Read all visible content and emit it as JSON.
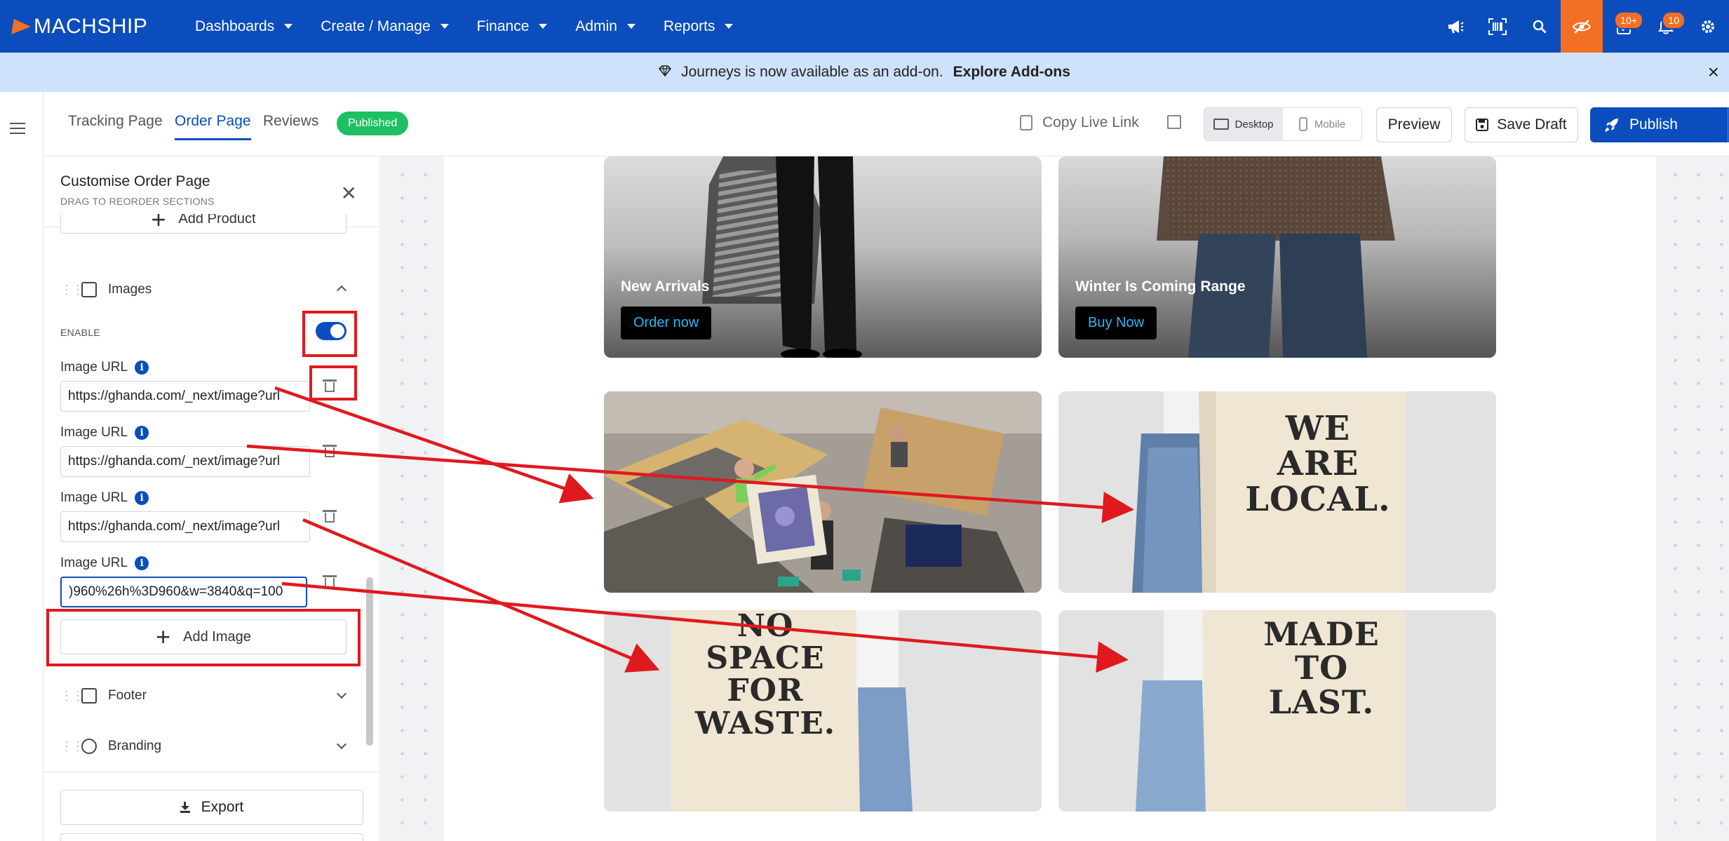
{
  "brand": {
    "logo_text": "MACHSHIP",
    "colors": {
      "primary": "#0b4dbd",
      "accent": "#f36f24",
      "success": "#1fbf63",
      "annotation": "#e0191f"
    }
  },
  "nav": {
    "items": [
      {
        "label": "Dashboards"
      },
      {
        "label": "Create / Manage"
      },
      {
        "label": "Finance"
      },
      {
        "label": "Admin"
      },
      {
        "label": "Reports"
      }
    ],
    "icons": [
      "megaphone-icon",
      "barcode-scan-icon",
      "search-icon",
      "eye-off-icon",
      "task-icon",
      "bell-icon",
      "gear-icon"
    ],
    "badges": {
      "tasks": "10+",
      "notifications": "10"
    }
  },
  "announcement": {
    "text": "Journeys is now available as an add-on.",
    "link": "Explore Add-ons",
    "close": "×"
  },
  "tabs": {
    "items": [
      {
        "label": "Tracking Page"
      },
      {
        "label": "Order Page"
      },
      {
        "label": "Reviews"
      }
    ],
    "status": "Published"
  },
  "toolbar": {
    "copy_link": "Copy Live Link",
    "desktop": "Desktop",
    "mobile": "Mobile",
    "preview": "Preview",
    "save_draft": "Save Draft",
    "publish": "Publish"
  },
  "panel": {
    "title": "Customise Order Page",
    "subtitle": "DRAG TO REORDER SECTIONS",
    "add_product": "Add Product",
    "images_section": "Images",
    "enable_label": "ENABLE",
    "enabled": true,
    "image_label": "Image URL",
    "image_urls": [
      "https://ghanda.com/_next/image?url",
      "https://ghanda.com/_next/image?url",
      "https://ghanda.com/_next/image?url",
      ")960%26h%3D960&w=3840&q=100"
    ],
    "add_image": "Add Image",
    "footer_section": "Footer",
    "branding_section": "Branding",
    "export": "Export"
  },
  "preview": {
    "cards": [
      {
        "title": "New Arrivals",
        "button": "Order now"
      },
      {
        "title": "Winter Is Coming Range",
        "button": "Buy Now"
      }
    ],
    "signs": {
      "we_are_local": [
        "WE",
        "ARE",
        "LOCAL."
      ],
      "no_space": [
        "NO",
        "SPACE",
        "FOR",
        "WASTE."
      ],
      "made_to_last": [
        "MADE",
        "TO",
        "LAST."
      ]
    }
  }
}
